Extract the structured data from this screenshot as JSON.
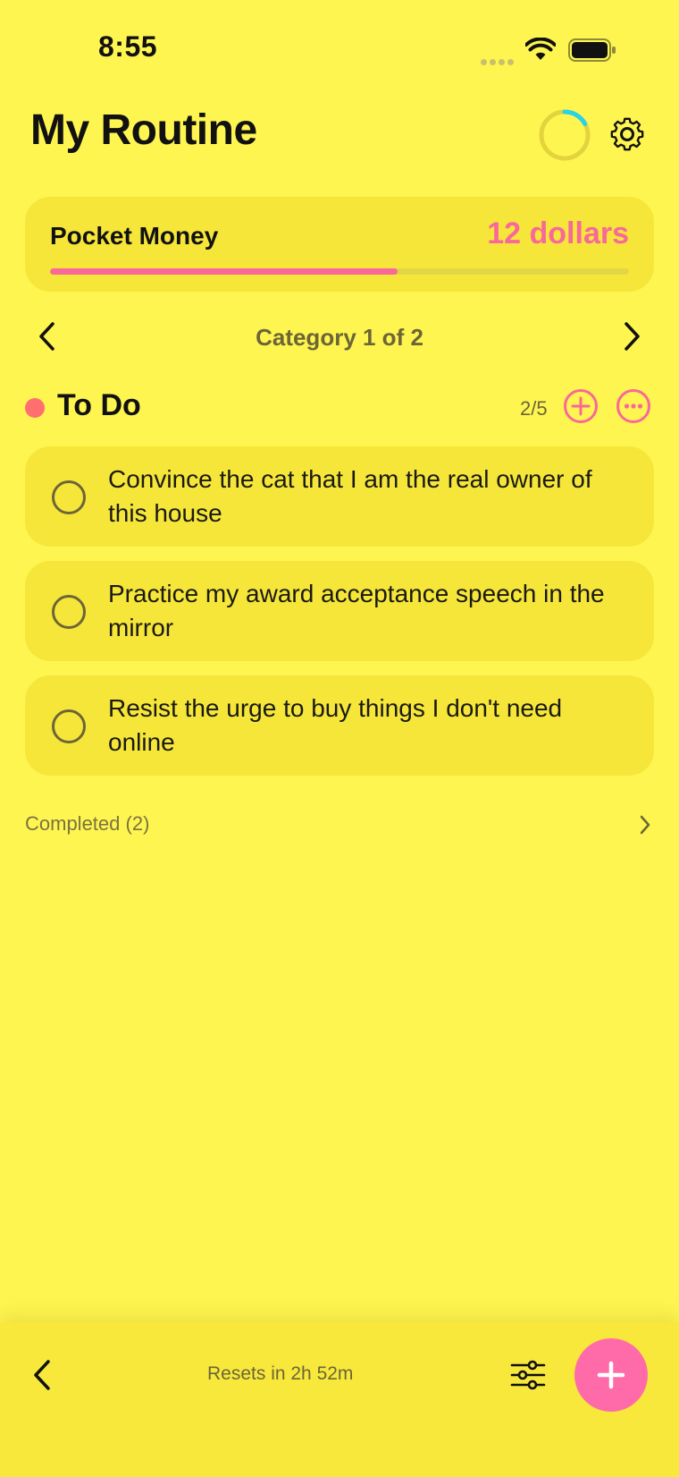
{
  "status_bar": {
    "time": "8:55"
  },
  "header": {
    "title": "My Routine",
    "progress_fraction": 0.17
  },
  "pocket_money": {
    "label": "Pocket Money",
    "value": "12 dollars",
    "progress_fraction": 0.6
  },
  "category_nav": {
    "label": "Category 1 of 2"
  },
  "section": {
    "title": "To Do",
    "count": "2/5",
    "dot_color": "#FF6F6F"
  },
  "tasks": [
    {
      "text": "Convince the cat that I am the real owner of this house",
      "done": false
    },
    {
      "text": "Practice my award acceptance speech in the mirror",
      "done": false
    },
    {
      "text": "Resist the urge to buy things I don't need online",
      "done": false
    }
  ],
  "completed": {
    "label": "Completed (2)"
  },
  "bottom_bar": {
    "reset_text": "Resets in 2h 52m"
  },
  "colors": {
    "background": "#FFF550",
    "card": "#F6E63A",
    "accent_pink": "#F8689A",
    "fab": "#FF6BA8",
    "ring_progress": "#27D3E8"
  },
  "icons": {
    "settings": "gear-icon",
    "prev": "chevron-left-icon",
    "next": "chevron-right-icon",
    "add": "plus-circle-icon",
    "more": "ellipsis-circle-icon",
    "filter": "sliders-icon",
    "fab": "plus-icon"
  }
}
